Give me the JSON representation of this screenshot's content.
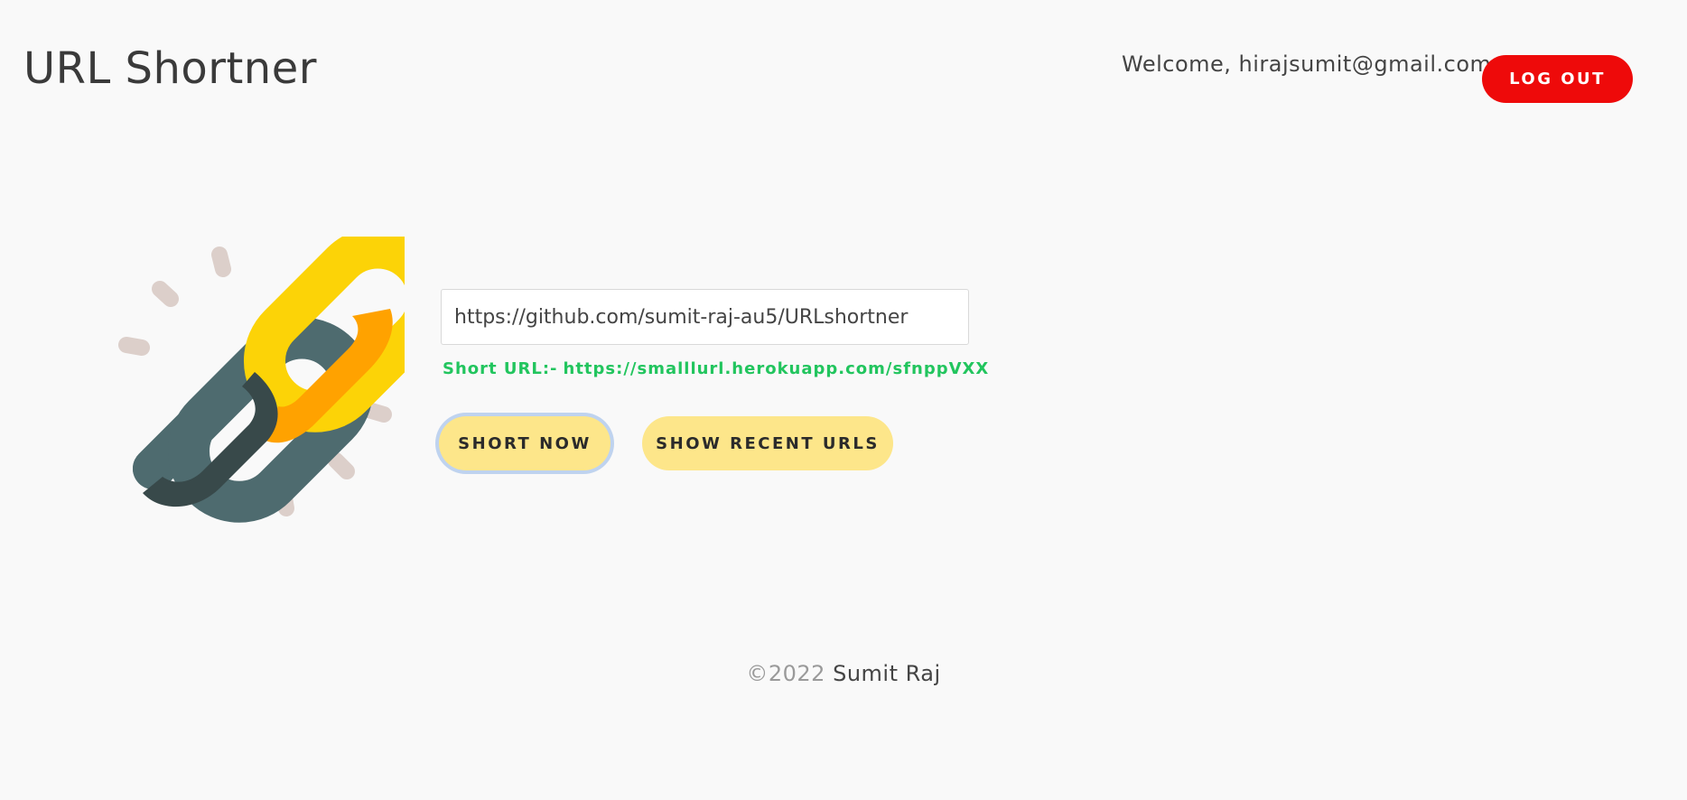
{
  "header": {
    "title": "URL Shortner",
    "welcome": "Welcome, hirajsumit@gmail.com",
    "logout_label": "LOG OUT"
  },
  "main": {
    "url_input_value": "https://github.com/sumit-raj-au5/URLshortner",
    "short_url_prefix": "Short URL:-",
    "short_url": "https://smalllurl.herokuapp.com/sfnppVXX",
    "short_now_label": "SHORT NOW",
    "show_recent_label": "SHOW RECENT URLS",
    "hero_icon": "chain-link-icon"
  },
  "footer": {
    "copyright": "©2022",
    "author": "Sumit Raj"
  },
  "colors": {
    "background": "#f9f9f9",
    "logout": "#ee0a0a",
    "primary_button": "#fde68a",
    "short_url": "#22c55e",
    "focus_ring": "#bfd3ef"
  }
}
